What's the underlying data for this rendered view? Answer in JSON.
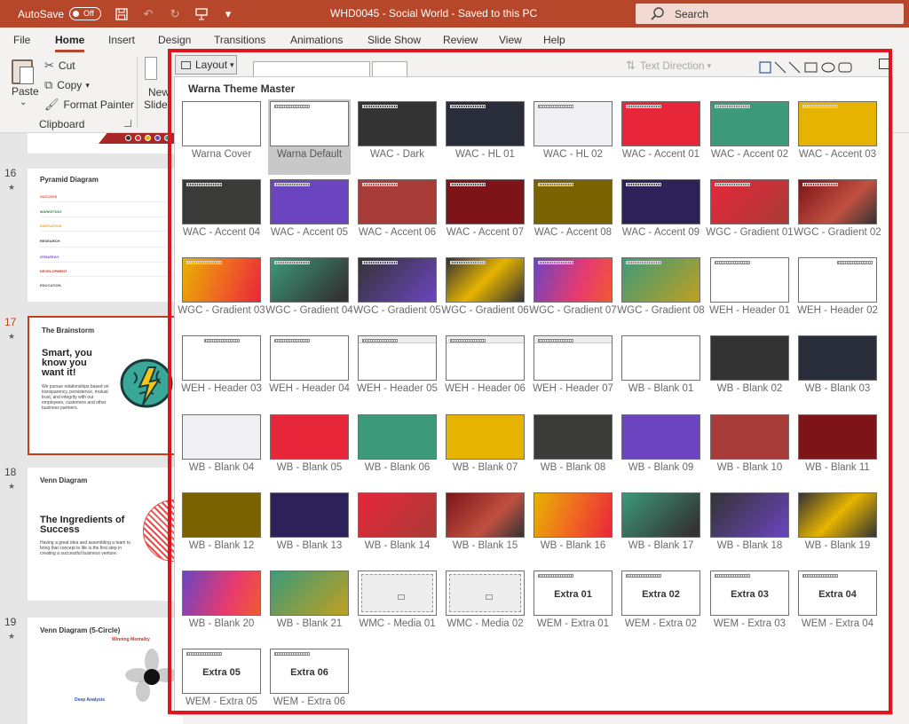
{
  "titlebar": {
    "autosave_label": "AutoSave",
    "toggle_state": "Off",
    "title": "WHD0045 - Social World  -  Saved to this PC",
    "search_placeholder": "Search"
  },
  "tabs": [
    "File",
    "Home",
    "Insert",
    "Design",
    "Transitions",
    "Animations",
    "Slide Show",
    "Review",
    "View",
    "Help"
  ],
  "active_tab": "Home",
  "ribbon": {
    "paste": "Paste",
    "cut": "Cut",
    "copy": "Copy",
    "format_painter": "Format Painter",
    "clipboard_group": "Clipboard",
    "new_slide_1": "New",
    "new_slide_2": "Slide",
    "layout_button": "Layout",
    "text_direction": "Text Direction"
  },
  "slides": [
    {
      "number": "16",
      "title": "Pyramid Diagram",
      "rows": [
        "SUCCESS",
        "MARKETING",
        "INNOVATION",
        "RESEARCH",
        "STRATEGY",
        "DEVELOPMENT",
        "EDUCATION"
      ],
      "row_colors": [
        "#e84c3d",
        "#2e8b57",
        "#e6a817",
        "#444444",
        "#6a3fb5",
        "#c0392b",
        "#555555"
      ]
    },
    {
      "number": "17",
      "title": "The Brainstorm",
      "headline": "Smart, you know you want it!",
      "body": "We pursue relationships based on transparency, persistence, mutual trust, and integrity with our employees, customers and other business partners.",
      "selected": true
    },
    {
      "number": "18",
      "title": "Venn Diagram",
      "headline": "The Ingredients of Success",
      "body": "Having a great idea and assembling a team to bring that concept to life is the first step in creating a successful business venture."
    },
    {
      "number": "19",
      "title": "Venn Diagram (5-Circle)",
      "labels": [
        "Winning Mentality",
        "Deep Analysis"
      ]
    }
  ],
  "gallery": {
    "header": "Warna Theme Master",
    "selected_index": 1,
    "layouts": [
      {
        "name": "Warna Cover",
        "bg": "#ffffff",
        "style": "plain"
      },
      {
        "name": "Warna Default",
        "bg": "#ffffff",
        "style": "tag"
      },
      {
        "name": "WAC - Dark",
        "bg": "#333333",
        "style": "tag-light"
      },
      {
        "name": "WAC - HL 01",
        "bg": "#2a2d3a",
        "style": "tag-light"
      },
      {
        "name": "WAC - HL 02",
        "bg": "#f0f0f4",
        "style": "tag"
      },
      {
        "name": "WAC - Accent 01",
        "bg": "#e8263a",
        "style": "tag-light"
      },
      {
        "name": "WAC - Accent 02",
        "bg": "#3c9a7a",
        "style": "tag-light"
      },
      {
        "name": "WAC - Accent 03",
        "bg": "#e6b400",
        "style": "tag-light"
      },
      {
        "name": "WAC - Accent 04",
        "bg": "#3a3a38",
        "style": "tag-light"
      },
      {
        "name": "WAC - Accent 05",
        "bg": "#6b45c0",
        "style": "tag-light"
      },
      {
        "name": "WAC - Accent 06",
        "bg": "#a83c38",
        "style": "tag-light"
      },
      {
        "name": "WAC - Accent 07",
        "bg": "#7c1418",
        "style": "tag-light"
      },
      {
        "name": "WAC - Accent 08",
        "bg": "#7a6200",
        "style": "tag-light"
      },
      {
        "name": "WAC - Accent 09",
        "bg": "#2e2058",
        "style": "tag-light"
      },
      {
        "name": "WGC - Gradient 01",
        "bg": "linear-gradient(135deg,#e8263a,#a83c38)",
        "style": "tag-light"
      },
      {
        "name": "WGC - Gradient 02",
        "bg": "linear-gradient(135deg,#7c1418,#c05040 60%,#333 100%)",
        "style": "tag-light"
      },
      {
        "name": "WGC - Gradient 03",
        "bg": "linear-gradient(110deg,#e6b400,#f06a20 50%,#e8263a)",
        "style": "tag-light"
      },
      {
        "name": "WGC - Gradient 04",
        "bg": "linear-gradient(135deg,#3c9a7a,#333 90%)",
        "style": "tag-light"
      },
      {
        "name": "WGC - Gradient 05",
        "bg": "linear-gradient(135deg,#333,#6b45c0)",
        "style": "tag-light"
      },
      {
        "name": "WGC - Gradient 06",
        "bg": "linear-gradient(135deg,#333,#e6b400 50%,#333)",
        "style": "tag-light"
      },
      {
        "name": "WGC - Gradient 07",
        "bg": "linear-gradient(110deg,#6b45c0,#e83a70 60%,#f05a30)",
        "style": "tag-light"
      },
      {
        "name": "WGC - Gradient 08",
        "bg": "linear-gradient(135deg,#3c9a7a,#c0a020)",
        "style": "tag-light"
      },
      {
        "name": "WEH - Header 01",
        "bg": "#ffffff",
        "style": "tag"
      },
      {
        "name": "WEH - Header 02",
        "bg": "#ffffff",
        "style": "tag-right"
      },
      {
        "name": "WEH - Header 03",
        "bg": "#ffffff",
        "style": "tag-center"
      },
      {
        "name": "WEH - Header 04",
        "bg": "#ffffff",
        "style": "tag"
      },
      {
        "name": "WEH - Header 05",
        "bg": "#ffffff",
        "style": "strip"
      },
      {
        "name": "WEH - Header 06",
        "bg": "#ffffff",
        "style": "strip"
      },
      {
        "name": "WEH - Header 07",
        "bg": "#ffffff",
        "style": "strip"
      },
      {
        "name": "WB - Blank 01",
        "bg": "#ffffff",
        "style": "plain"
      },
      {
        "name": "WB - Blank 02",
        "bg": "#333333",
        "style": "plain"
      },
      {
        "name": "WB - Blank 03",
        "bg": "#2a2d3a",
        "style": "plain"
      },
      {
        "name": "WB - Blank 04",
        "bg": "#f0f0f4",
        "style": "plain"
      },
      {
        "name": "WB - Blank 05",
        "bg": "#e8263a",
        "style": "plain"
      },
      {
        "name": "WB - Blank 06",
        "bg": "#3c9a7a",
        "style": "plain"
      },
      {
        "name": "WB - Blank 07",
        "bg": "#e6b400",
        "style": "plain"
      },
      {
        "name": "WB - Blank 08",
        "bg": "#3a3a38",
        "style": "plain"
      },
      {
        "name": "WB - Blank 09",
        "bg": "#6b45c0",
        "style": "plain"
      },
      {
        "name": "WB - Blank 10",
        "bg": "#a83c38",
        "style": "plain"
      },
      {
        "name": "WB - Blank 11",
        "bg": "#7c1418",
        "style": "plain"
      },
      {
        "name": "WB - Blank 12",
        "bg": "#7a6200",
        "style": "plain"
      },
      {
        "name": "WB - Blank 13",
        "bg": "#2e2058",
        "style": "plain"
      },
      {
        "name": "WB - Blank 14",
        "bg": "linear-gradient(135deg,#e8263a,#a83c38)",
        "style": "plain"
      },
      {
        "name": "WB - Blank 15",
        "bg": "linear-gradient(135deg,#7c1418,#c05040 60%,#333 100%)",
        "style": "plain"
      },
      {
        "name": "WB - Blank 16",
        "bg": "linear-gradient(110deg,#e6b400,#f06a20 50%,#e8263a)",
        "style": "plain"
      },
      {
        "name": "WB - Blank 17",
        "bg": "linear-gradient(135deg,#3c9a7a,#333 90%)",
        "style": "plain"
      },
      {
        "name": "WB - Blank 18",
        "bg": "linear-gradient(135deg,#333,#6b45c0)",
        "style": "plain"
      },
      {
        "name": "WB - Blank 19",
        "bg": "linear-gradient(135deg,#333,#e6b400 50%,#333)",
        "style": "plain"
      },
      {
        "name": "WB - Blank 20",
        "bg": "linear-gradient(110deg,#6b45c0,#e83a70 60%,#f05a30)",
        "style": "plain"
      },
      {
        "name": "WB - Blank 21",
        "bg": "linear-gradient(135deg,#3c9a7a,#c0a020)",
        "style": "plain"
      },
      {
        "name": "WMC - Media 01",
        "bg": "#ffffff",
        "style": "media"
      },
      {
        "name": "WMC - Media 02",
        "bg": "#ffffff",
        "style": "media"
      },
      {
        "name": "WEM - Extra 01",
        "bg": "#ffffff",
        "style": "extra",
        "label": "Extra 01"
      },
      {
        "name": "WEM - Extra 02",
        "bg": "#ffffff",
        "style": "extra",
        "label": "Extra 02"
      },
      {
        "name": "WEM - Extra 03",
        "bg": "#ffffff",
        "style": "extra",
        "label": "Extra 03"
      },
      {
        "name": "WEM - Extra 04",
        "bg": "#ffffff",
        "style": "extra",
        "label": "Extra 04"
      },
      {
        "name": "WEM - Extra 05",
        "bg": "#ffffff",
        "style": "extra",
        "label": "Extra 05"
      },
      {
        "name": "WEM - Extra 06",
        "bg": "#ffffff",
        "style": "extra",
        "label": "Extra 06"
      }
    ]
  },
  "colors": {
    "titlebar": "#b7472a",
    "highlight_border": "#e0141c",
    "selected_slide_border": "#c43e1c"
  }
}
